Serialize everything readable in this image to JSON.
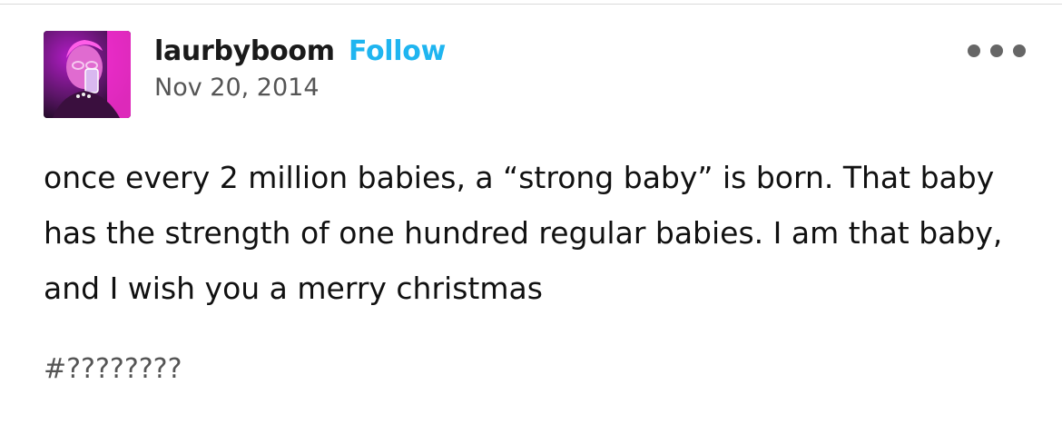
{
  "post": {
    "blog_name": "laurbyboom",
    "follow_label": "Follow",
    "date": "Nov 20, 2014",
    "body_text": "once every 2 million babies, a “strong baby” is born. That baby has the strength of one hundred regular babies. I am that baby, and I wish you a merry christmas",
    "tags": "#????????",
    "more_icon": "ellipsis-icon"
  },
  "colors": {
    "follow": "#1fb5f0",
    "date": "#555555",
    "avatar_bg": "#2a0d2e",
    "avatar_accent": "#e020e0"
  }
}
